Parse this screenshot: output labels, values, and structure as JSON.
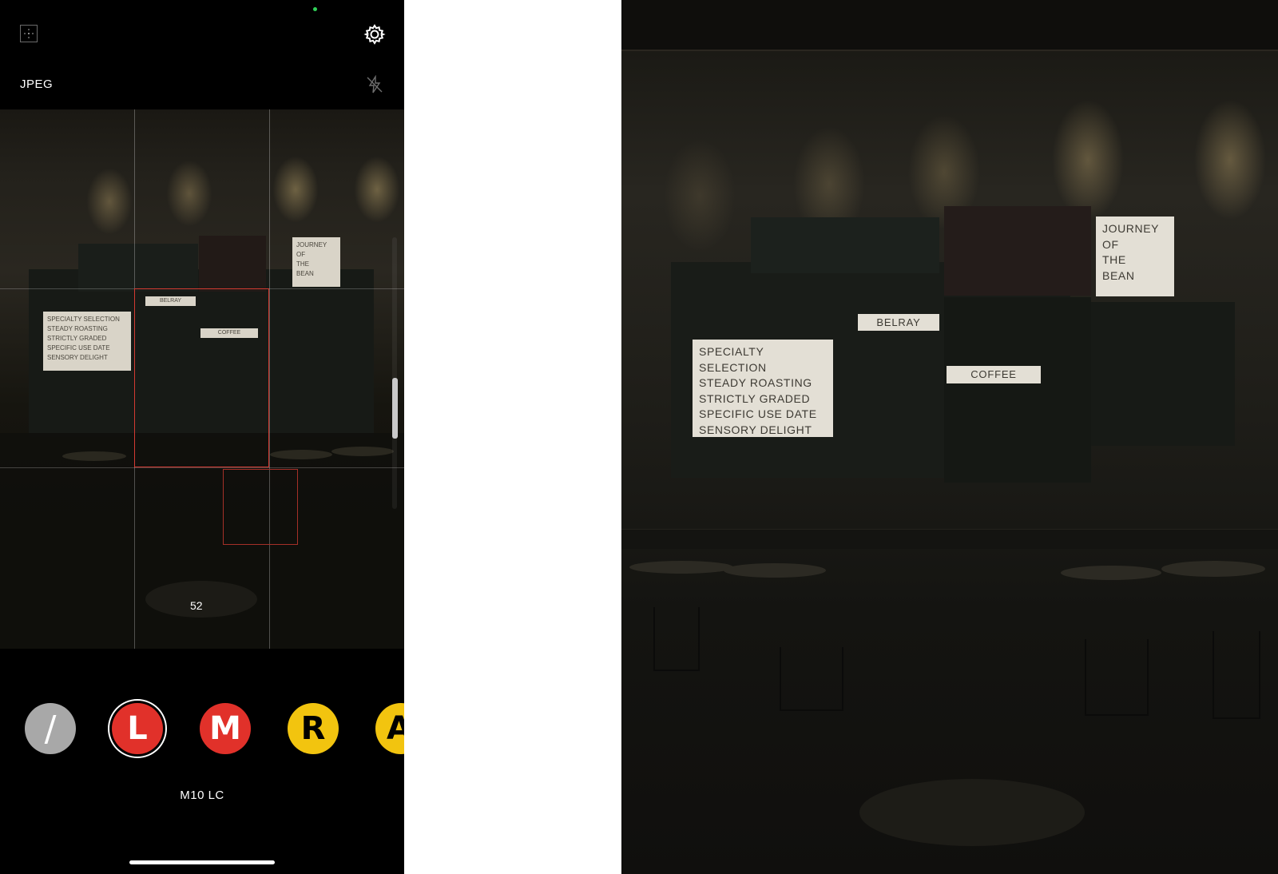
{
  "camera": {
    "format_label": "JPEG",
    "focal_readout": "52",
    "camera_model": "M10 LC",
    "lenses": [
      {
        "label": "/",
        "color": "#a8a8a8",
        "selected": false
      },
      {
        "label": "L",
        "color": "#e1312a",
        "selected": true
      },
      {
        "label": "M",
        "color": "#e1312a",
        "selected": false
      },
      {
        "label": "R",
        "color": "#f2c40f",
        "selected": false
      },
      {
        "label": "A",
        "color": "#f2c40f",
        "selected": false
      }
    ],
    "icons": {
      "grid": "grid-toggle-icon",
      "settings": "gear-icon",
      "flash": "flash-off-icon",
      "recording": "recording-dot-icon"
    },
    "colors": {
      "frame": "#d33a32",
      "accent_green": "#30d158"
    }
  },
  "scene": {
    "sign_list": [
      "SPECIALTY SELECTION",
      "STEADY ROASTING",
      "STRICTLY GRADED",
      "SPECIFIC USE DATE",
      "SENSORY DELIGHT"
    ],
    "sign_journey": [
      "JOURNEY",
      "OF",
      "THE",
      "BEAN"
    ],
    "tag_belray": "BELRAY",
    "tag_coffee": "COFFEE"
  }
}
